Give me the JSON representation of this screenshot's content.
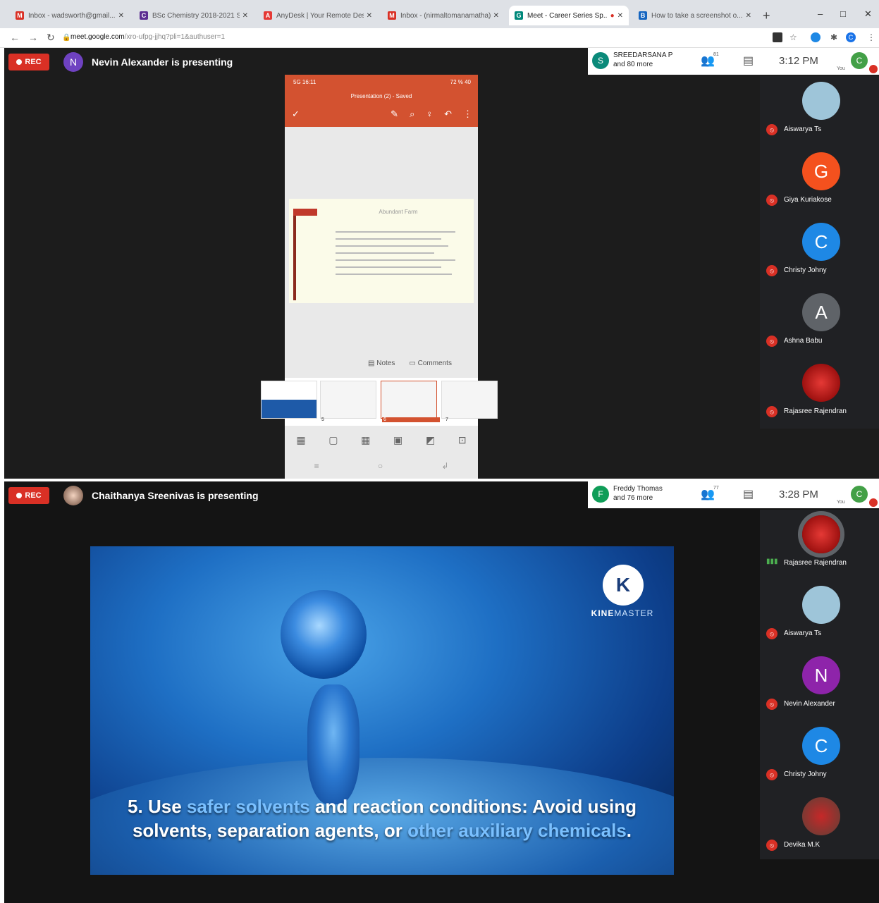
{
  "browser": {
    "tabs": [
      {
        "title": "Inbox - wadsworth@gmail...",
        "fav": "M",
        "color": "#d93025"
      },
      {
        "title": "BSc Chemistry 2018-2021 Sc...",
        "fav": "C",
        "color": "#5c2d91"
      },
      {
        "title": "AnyDesk | Your Remote Des...",
        "fav": "A",
        "color": "#e53935"
      },
      {
        "title": "Inbox - (nirmaltomanamatha)...",
        "fav": "M",
        "color": "#d93025"
      },
      {
        "title": "Meet - Career Series Sp...",
        "fav": "G",
        "color": "#00897b"
      },
      {
        "title": "How to take a screenshot o...",
        "fav": "B",
        "color": "#1565c0"
      }
    ],
    "new_tab_icon": "+",
    "url_host": "meet.google.com",
    "url_path": "/xro-ufpg-jjhq?pli=1&authuser=1",
    "window_controls": {
      "min": "–",
      "max": "□",
      "close": "✕"
    }
  },
  "meeting1": {
    "rec_label": "REC",
    "presenter_initial": "N",
    "presenter_color": "#6f42c1",
    "presenting_text": "Nevin Alexander is presenting",
    "participants_initial": "S",
    "participants_name": "SREEDARSANA P",
    "participants_more": "and 80 more",
    "people_count": "81",
    "time": "3:12 PM",
    "you_label": "You",
    "self_initial": "C",
    "sidebar": [
      {
        "name": "Aiswarya Ts",
        "initial": "",
        "color": "#9ec5d9"
      },
      {
        "name": "Giya Kuriakose",
        "initial": "G",
        "color": "#f4511e"
      },
      {
        "name": "Christy Johny",
        "initial": "C",
        "color": "#1e88e5"
      },
      {
        "name": "Ashna Babu",
        "initial": "A",
        "color": "#5f6368"
      },
      {
        "name": "Rajasree Rajendran",
        "initial": "",
        "color": "#b71c1c"
      }
    ],
    "phone": {
      "status_left": "5G 16:11",
      "status_right": "72 % 40",
      "title": "Presentation (2) - Saved",
      "slide_title": "Abundant Farm",
      "notes_label": "Notes",
      "comments_label": "Comments",
      "thumbs": [
        "5",
        "6",
        "7"
      ]
    }
  },
  "meeting2": {
    "rec_label": "REC",
    "presenting_text": "Chaithanya Sreenivas is presenting",
    "participants_initial": "F",
    "participants_name": "Freddy Thomas",
    "participants_more": "and 76 more",
    "people_count": "77",
    "time": "3:28 PM",
    "you_label": "You",
    "self_initial": "C",
    "sidebar": [
      {
        "name": "Rajasree Rajendran",
        "initial": "",
        "color": "#b71c1c",
        "speaking": true
      },
      {
        "name": "Aiswarya Ts",
        "initial": "",
        "color": "#9ec5d9",
        "speaking": false
      },
      {
        "name": "Nevin Alexander",
        "initial": "N",
        "color": "#8e24aa",
        "speaking": false
      },
      {
        "name": "Christy Johny",
        "initial": "C",
        "color": "#1e88e5",
        "speaking": false
      },
      {
        "name": "Devika M.K",
        "initial": "",
        "color": "#8d6e63",
        "speaking": false
      }
    ],
    "video": {
      "logo_letter": "K",
      "brand_a": "KINE",
      "brand_b": "MASTER",
      "cap_1": "5. Use ",
      "cap_2": "safer solvents",
      "cap_3": " and reaction conditions: Avoid using",
      "cap_4": "solvents, separation agents, or ",
      "cap_5": "other auxiliary chemicals",
      "cap_6": "."
    }
  }
}
